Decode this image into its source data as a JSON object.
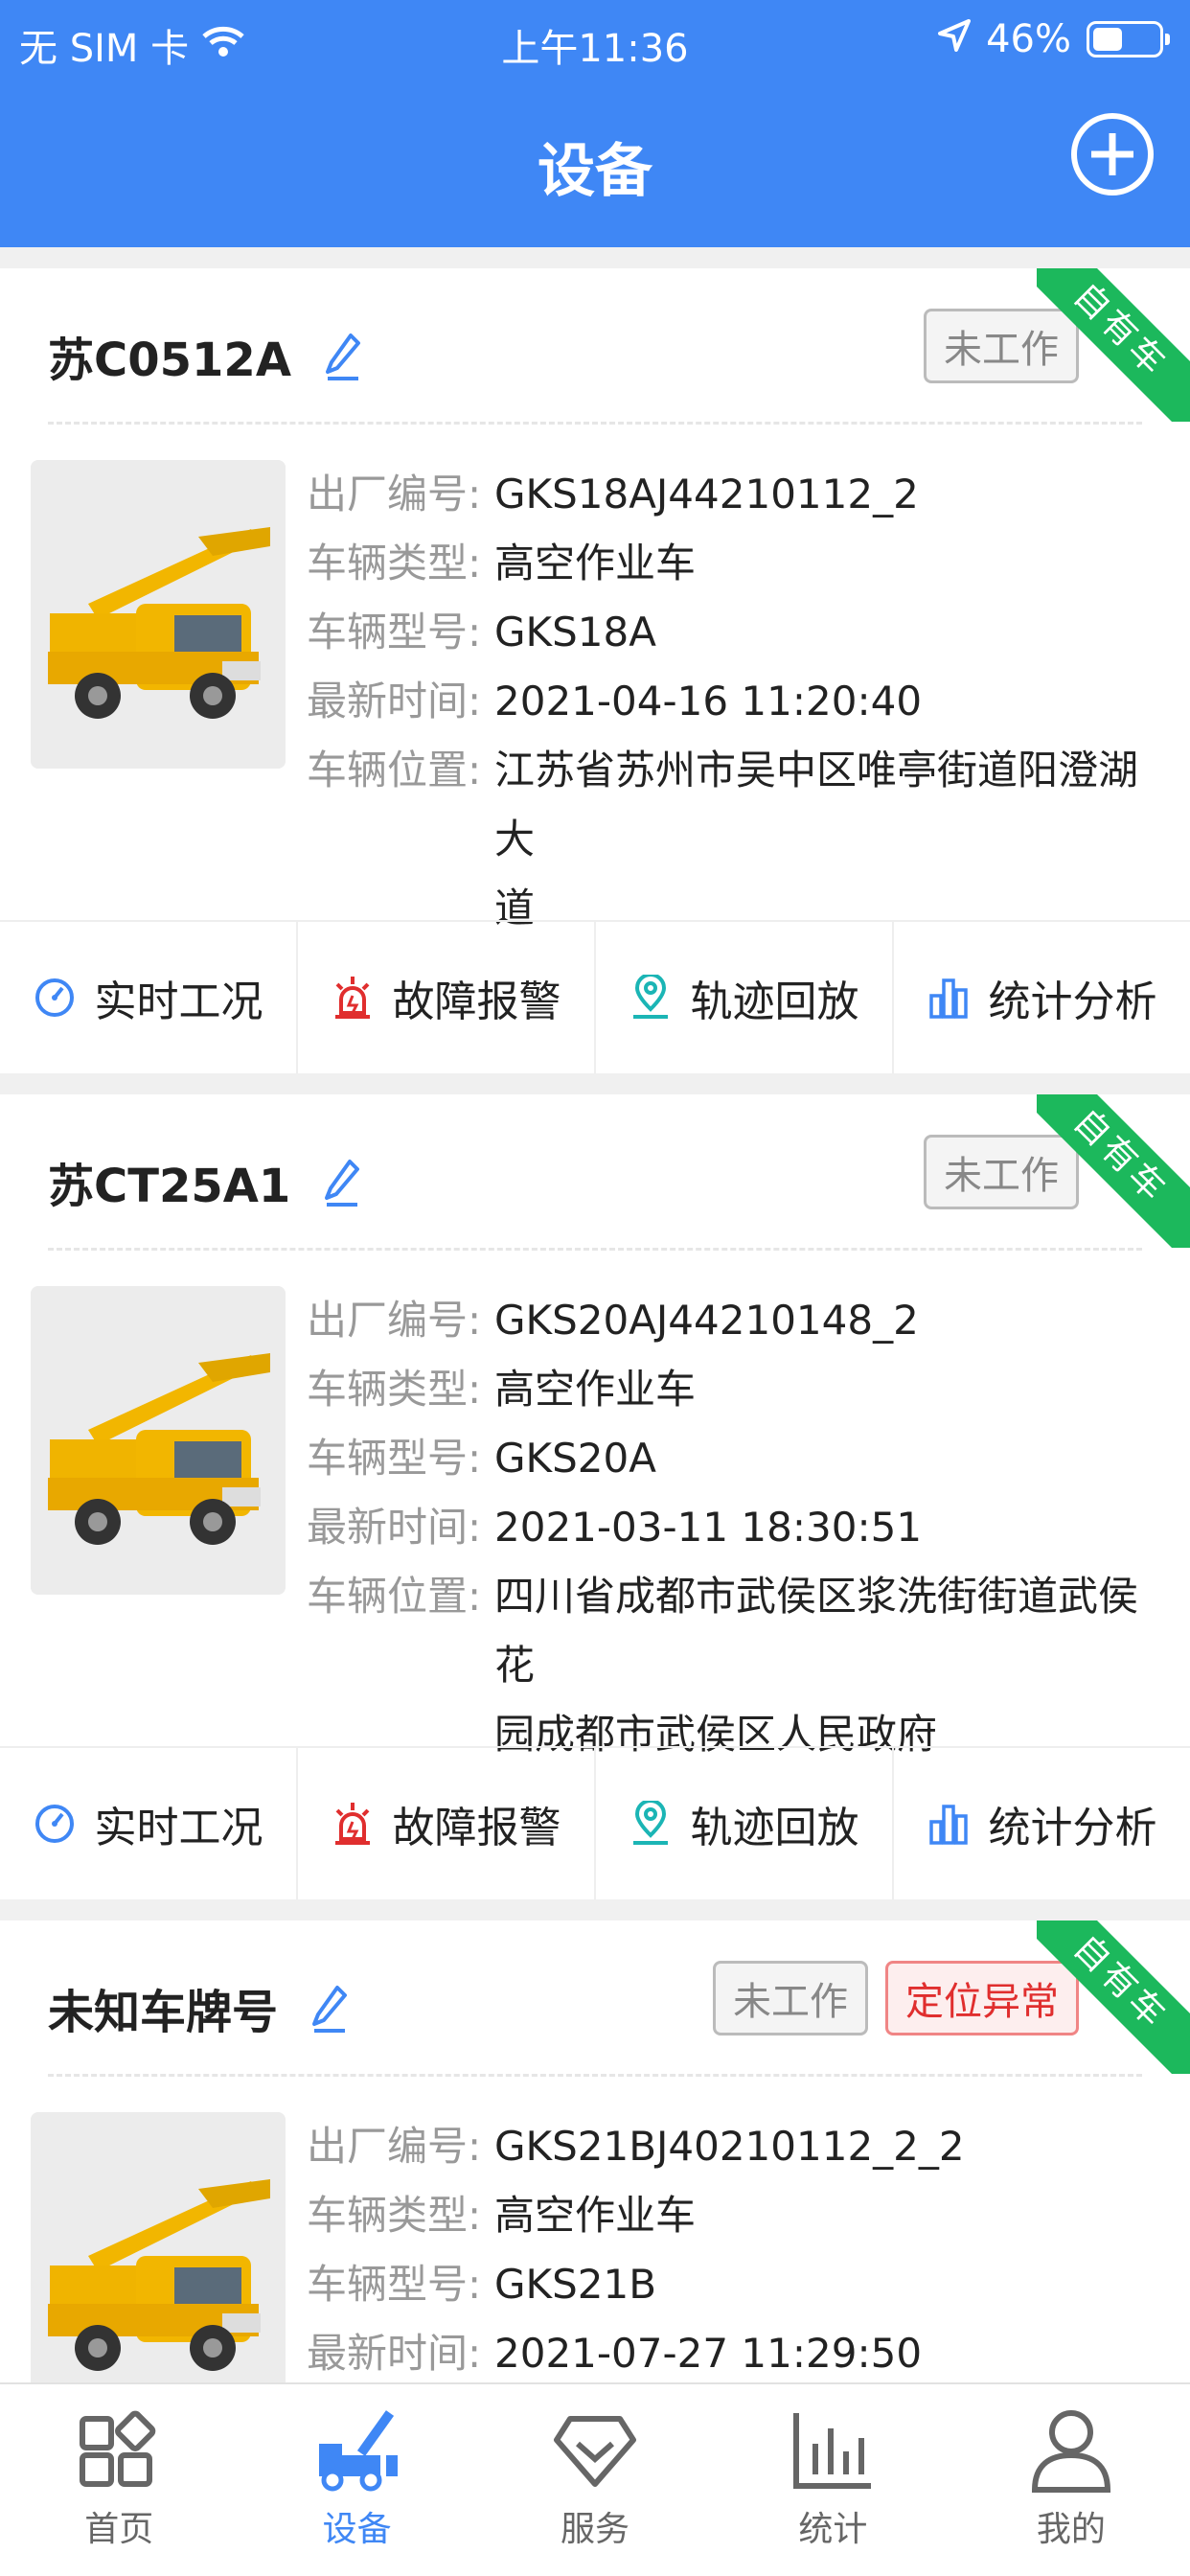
{
  "status_bar": {
    "carrier": "无 SIM 卡",
    "time": "上午11:36",
    "battery": "46%",
    "battery_level": 0.46
  },
  "header": {
    "title": "设备"
  },
  "colors": {
    "brand": "#3f87f5",
    "ribbon": "#1cb85c",
    "warn": "#e02e2e"
  },
  "labels": {
    "serial": "出厂编号:",
    "type": "车辆类型:",
    "model": "车辆型号:",
    "time": "最新时间:",
    "location": "车辆位置:"
  },
  "actions": [
    "实时工况",
    "故障报警",
    "轨迹回放",
    "统计分析"
  ],
  "devices": [
    {
      "plate": "苏C0512A",
      "ribbon": "自有车",
      "status": "未工作",
      "serial": "GKS18AJ44210112_2",
      "type": "高空作业车",
      "model": "GKS18A",
      "time": "2021-04-16 11:20:40",
      "location_line1": "江苏省苏州市吴中区唯亭街道阳澄湖大",
      "location_line2": "道"
    },
    {
      "plate": "苏CT25A1",
      "ribbon": "自有车",
      "status": "未工作",
      "serial": "GKS20AJ44210148_2",
      "type": "高空作业车",
      "model": "GKS20A",
      "time": "2021-03-11 18:30:51",
      "location_line1": "四川省成都市武侯区浆洗街街道武侯花",
      "location_line2": "园成都市武侯区人民政府"
    },
    {
      "plate": "未知车牌号",
      "ribbon": "自有车",
      "status": "未工作",
      "alert": "定位异常",
      "serial": "GKS21BJ40210112_2_2",
      "type": "高空作业车",
      "model": "GKS21B",
      "time": "2021-07-27 11:29:50"
    }
  ],
  "tabbar": [
    {
      "label": "首页",
      "icon": "home-icon"
    },
    {
      "label": "设备",
      "icon": "truck-icon",
      "active": true
    },
    {
      "label": "服务",
      "icon": "diamond-icon"
    },
    {
      "label": "统计",
      "icon": "bar-chart-icon"
    },
    {
      "label": "我的",
      "icon": "user-icon"
    }
  ]
}
